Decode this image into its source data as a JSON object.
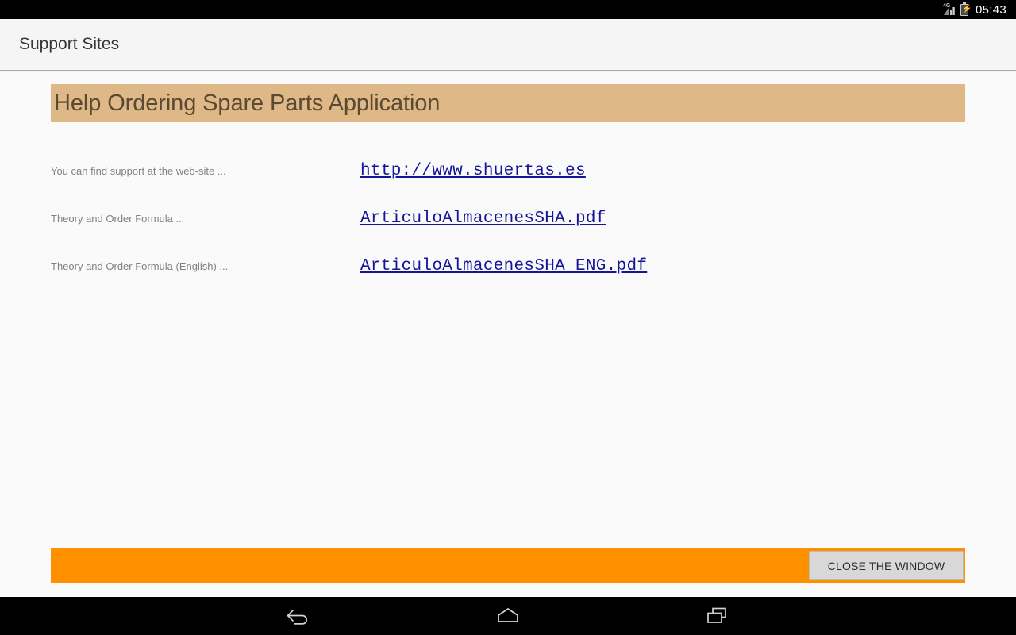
{
  "status_bar": {
    "network_label": "4G",
    "signal_icon": "signal-bars-icon",
    "battery_icon": "battery-charging-icon",
    "clock": "05:43"
  },
  "app_bar": {
    "title": "Support Sites"
  },
  "banner": {
    "title": "Help Ordering Spare Parts Application",
    "background_color": "#deb887",
    "text_color": "#5a4a33"
  },
  "rows": [
    {
      "label": "You can find support at the web-site ...",
      "link": "http://www.shuertas.es"
    },
    {
      "label": "Theory and Order Formula ...",
      "link": "ArticuloAlmacenesSHA.pdf"
    },
    {
      "label": "Theory and Order Formula (English) ...",
      "link": "ArticuloAlmacenesSHA_ENG.pdf"
    }
  ],
  "action_bar": {
    "background_color": "#ff9000",
    "close_label": "CLOSE THE WINDOW"
  },
  "nav_bar": {
    "back_icon": "back-arrow-icon",
    "home_icon": "home-icon",
    "recents_icon": "recent-apps-icon"
  },
  "colors": {
    "page_background": "#fafafa",
    "link_color": "#14149b",
    "label_color": "#818181"
  }
}
